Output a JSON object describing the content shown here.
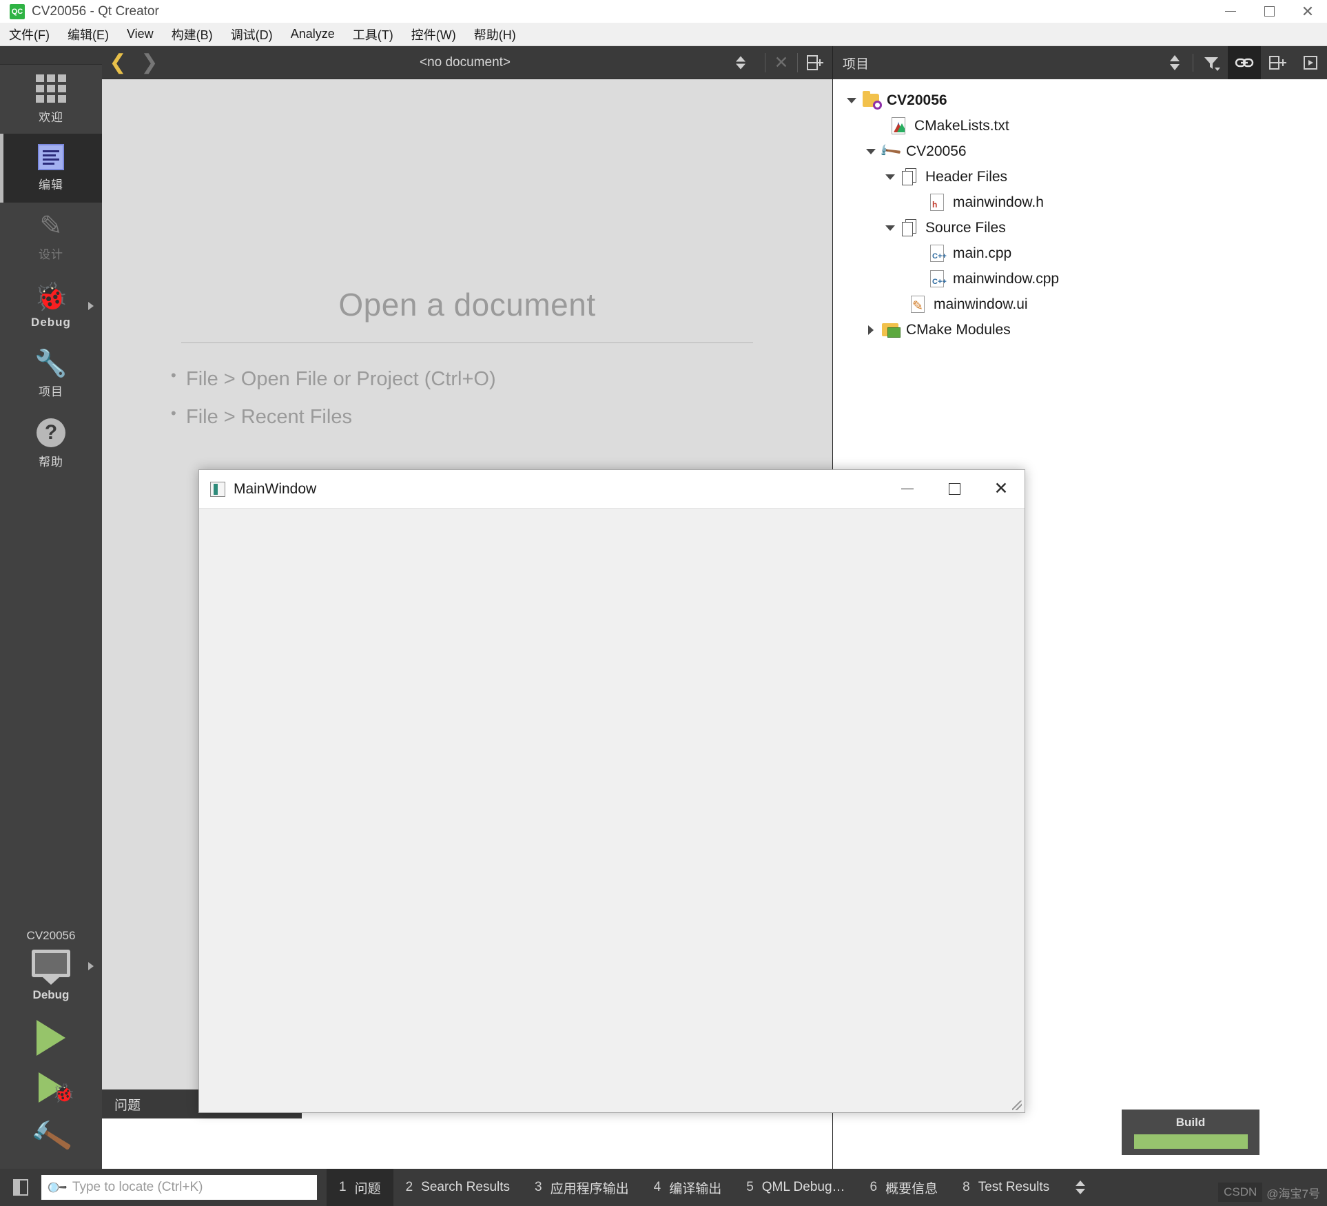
{
  "window": {
    "title": "CV20056 - Qt Creator",
    "app_icon": "qt-creator-icon",
    "minimize_label": "Minimize",
    "maximize_label": "Maximize",
    "close_label": "Close"
  },
  "menubar": {
    "items": [
      {
        "label": "文件(F)",
        "mnemonic": "F"
      },
      {
        "label": "编辑(E)",
        "mnemonic": "E"
      },
      {
        "label": "View",
        "mnemonic": "V"
      },
      {
        "label": "构建(B)",
        "mnemonic": "B"
      },
      {
        "label": "调试(D)",
        "mnemonic": "D"
      },
      {
        "label": "Analyze",
        "mnemonic": "A"
      },
      {
        "label": "工具(T)",
        "mnemonic": "T"
      },
      {
        "label": "控件(W)",
        "mnemonic": "W"
      },
      {
        "label": "帮助(H)",
        "mnemonic": "H"
      }
    ]
  },
  "modebar": {
    "items": [
      {
        "label": "欢迎",
        "icon": "grid-icon",
        "state": "normal"
      },
      {
        "label": "编辑",
        "icon": "edit-lines-icon",
        "state": "active"
      },
      {
        "label": "设计",
        "icon": "pencil-icon",
        "state": "disabled"
      },
      {
        "label": "Debug",
        "icon": "bug-icon",
        "state": "normal",
        "has_arrow": true
      },
      {
        "label": "项目",
        "icon": "wrench-icon",
        "state": "normal"
      },
      {
        "label": "帮助",
        "icon": "question-circle-icon",
        "state": "normal"
      }
    ]
  },
  "runcontrols": {
    "kit_name": "CV20056",
    "kit_config": "Debug",
    "kit_icon": "desktop-monitor-icon",
    "run_label": "Run",
    "debug_label": "Start Debugging",
    "build_label": "Build Project"
  },
  "editor_toolbar": {
    "back_label": "Go Back",
    "forward_label": "Go Forward",
    "document": "<no document>",
    "close_label": "Close Document",
    "split_label": "Split"
  },
  "editor_placeholder": {
    "title": "Open a document",
    "hints": [
      "File > Open File or Project (Ctrl+O)",
      "File > Recent Files"
    ]
  },
  "issues_pane": {
    "tab_label": "问题"
  },
  "project_panel": {
    "title": "项目",
    "tools": [
      {
        "name": "sync-arrows-icon",
        "label": "Synchronize",
        "active": false
      },
      {
        "name": "filter-icon",
        "label": "Filter Tree",
        "active": false
      },
      {
        "name": "link-icon",
        "label": "Synchronize with Editor",
        "active": true
      },
      {
        "name": "split-add-icon",
        "label": "Split",
        "active": false
      },
      {
        "name": "close-panel-icon",
        "label": "Close Sidebar",
        "active": false
      }
    ],
    "tree": [
      {
        "label": "CV20056",
        "icon": "project-folder-icon",
        "indent": 0,
        "expander": "down",
        "bold": true
      },
      {
        "label": "CMakeLists.txt",
        "icon": "cmake-file-icon",
        "indent": 1,
        "expander": "none",
        "bold": false
      },
      {
        "label": "CV20056",
        "icon": "build-target-icon",
        "indent": 1,
        "expander": "down",
        "bold": false
      },
      {
        "label": "Header Files",
        "icon": "files-group-icon",
        "indent": 2,
        "expander": "down",
        "bold": false
      },
      {
        "label": "mainwindow.h",
        "icon": "header-file-icon",
        "indent": 3,
        "expander": "none",
        "bold": false
      },
      {
        "label": "Source Files",
        "icon": "files-group-icon",
        "indent": 2,
        "expander": "down",
        "bold": false
      },
      {
        "label": "main.cpp",
        "icon": "cpp-file-icon",
        "indent": 3,
        "expander": "none",
        "bold": false
      },
      {
        "label": "mainwindow.cpp",
        "icon": "cpp-file-icon",
        "indent": 3,
        "expander": "none",
        "bold": false
      },
      {
        "label": "mainwindow.ui",
        "icon": "ui-file-icon",
        "indent": 2,
        "expander": "none",
        "bold": false
      },
      {
        "label": "CMake Modules",
        "icon": "cmake-modules-icon",
        "indent": 1,
        "expander": "right",
        "bold": false
      }
    ]
  },
  "mainwindow_dialog": {
    "title": "MainWindow",
    "icon": "qt-window-icon",
    "minimize_label": "Minimize",
    "maximize_label": "Maximize",
    "close_label": "Close"
  },
  "build_progress": {
    "label": "Build",
    "percent": 100,
    "bar_color": "#97c46e"
  },
  "statusbar": {
    "sidebar_toggle_label": "Toggle Sidebar",
    "locator_placeholder": "Type to locate (Ctrl+K)",
    "locator_value": "",
    "panes": [
      {
        "num": "1",
        "label": "问题",
        "active": true
      },
      {
        "num": "2",
        "label": "Search Results",
        "active": false
      },
      {
        "num": "3",
        "label": "应用程序输出",
        "active": false
      },
      {
        "num": "4",
        "label": "编译输出",
        "active": false
      },
      {
        "num": "5",
        "label": "QML Debug…",
        "active": false
      },
      {
        "num": "6",
        "label": "概要信息",
        "active": false
      },
      {
        "num": "8",
        "label": "Test Results",
        "active": false
      }
    ],
    "watermark_badge": "CSDN",
    "watermark_text": "@海宝7号"
  },
  "colors": {
    "chrome_dark": "#3a3a3a",
    "mode_active": "#2b2b2b",
    "accent_yellow": "#e8c04a",
    "build_green": "#97c46e",
    "editor_bg": "#dcdcdc"
  }
}
